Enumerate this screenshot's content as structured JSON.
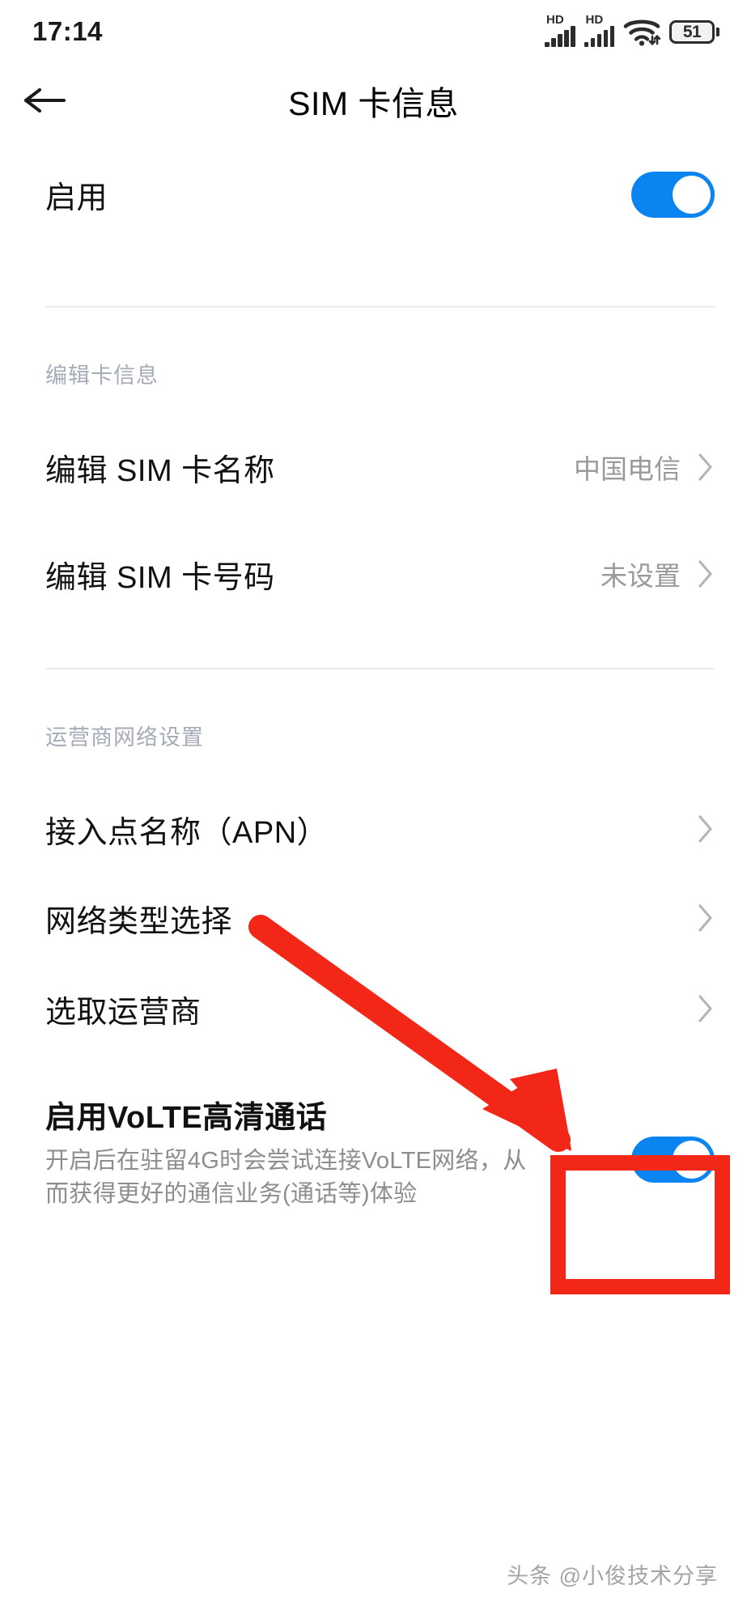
{
  "statusbar": {
    "time": "17:14",
    "battery_level": "51",
    "signal1_label": "HD",
    "signal2_label": "HD",
    "icons": [
      "hd-signal-icon",
      "hd-signal-icon",
      "wifi-icon",
      "battery-icon"
    ]
  },
  "appbar": {
    "back_icon": "back-arrow-icon",
    "title": "SIM 卡信息"
  },
  "enable_row": {
    "label": "启用",
    "toggle_state": "on"
  },
  "card_section": {
    "header": "编辑卡信息",
    "items": [
      {
        "label": "编辑 SIM 卡名称",
        "value": "中国电信",
        "chevron": "chevron-right-icon"
      },
      {
        "label": "编辑 SIM 卡号码",
        "value": "未设置",
        "chevron": "chevron-right-icon"
      }
    ]
  },
  "carrier_section": {
    "header": "运营商网络设置",
    "items": [
      {
        "label": "接入点名称（APN）",
        "value": "",
        "chevron": "chevron-right-icon"
      },
      {
        "label": "网络类型选择",
        "value": "",
        "chevron": "chevron-right-icon"
      },
      {
        "label": "选取运营商",
        "value": "",
        "chevron": "chevron-right-icon"
      }
    ]
  },
  "volte_row": {
    "title": "启用VoLTE高清通话",
    "description": "开启后在驻留4G时会尝试连接VoLTE网络，从而获得更好的通信业务(通话等)体验",
    "toggle_state": "on"
  },
  "annotations": {
    "arrow_color": "#f22718",
    "box_color": "#f22718",
    "arrow_name": "red-pointer-arrow",
    "box_name": "red-highlight-box"
  },
  "watermark": {
    "text": "头条 @小俊技术分享"
  },
  "colors": {
    "toggle_on": "#0a84f0",
    "accent_red": "#f22718",
    "text_primary": "#111111",
    "text_secondary": "#9a9a9a",
    "section_label": "#a6abb8",
    "divider": "#ececec"
  }
}
